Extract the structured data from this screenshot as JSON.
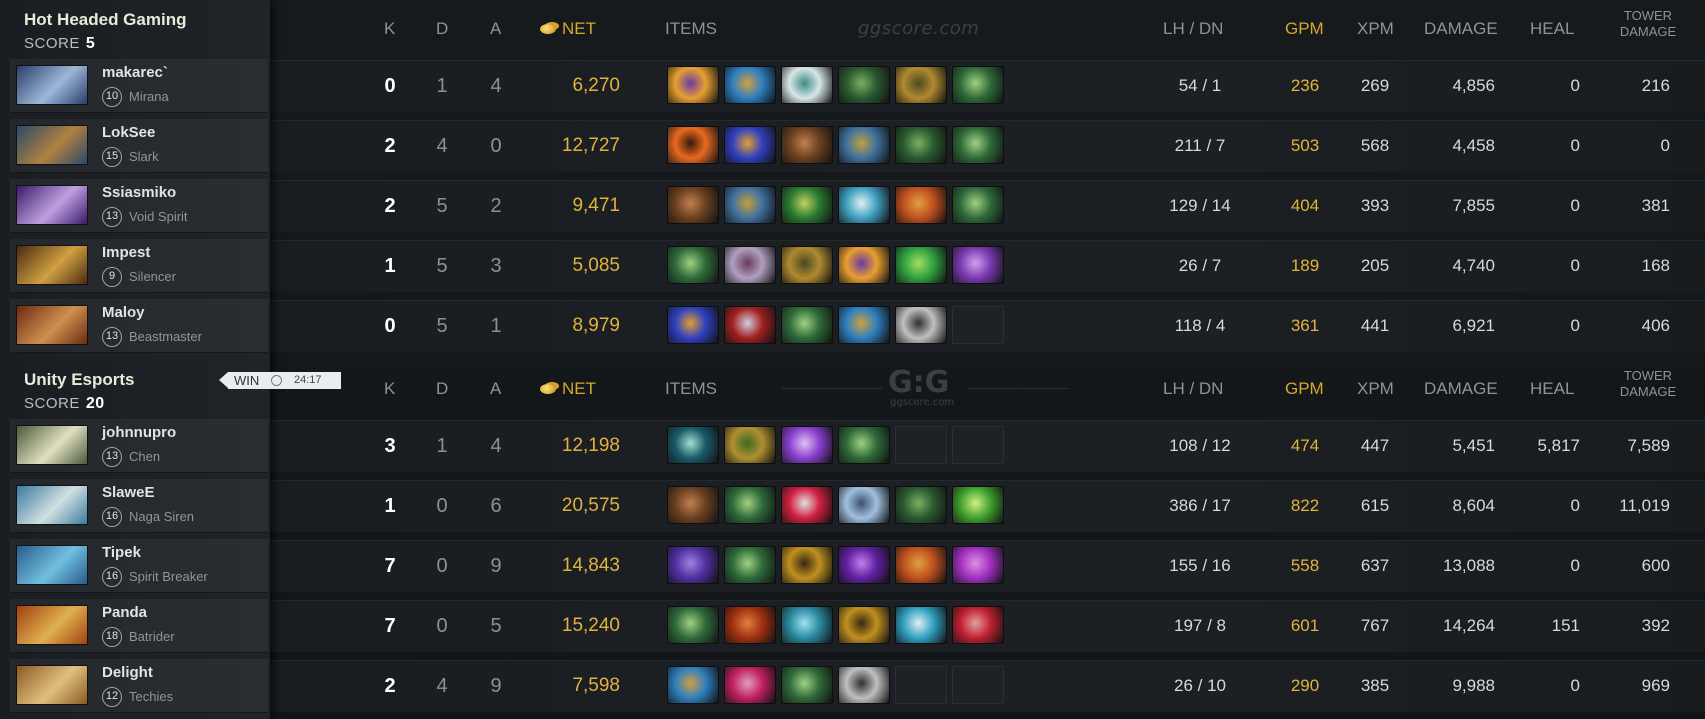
{
  "watermark": {
    "top": "ggscore.com",
    "logo": "G:G",
    "logo_sub": "ggscore.com"
  },
  "headers": {
    "k": "K",
    "d": "D",
    "a": "A",
    "net": "NET",
    "items": "ITEMS",
    "lhdn": "LH  /  DN",
    "gpm": "GPM",
    "xpm": "XPM",
    "damage": "DAMAGE",
    "heal": "HEAL",
    "tower_l1": "TOWER",
    "tower_l2": "DAMAGE"
  },
  "result": {
    "label": "WIN",
    "time": "24:17"
  },
  "teams": [
    {
      "name": "Hot Headed Gaming",
      "score_label": "SCORE",
      "score": "5",
      "players": [
        {
          "name": "makarec`",
          "level": "10",
          "hero": "Mirana",
          "k": "0",
          "d": "1",
          "a": "4",
          "net": "6,270",
          "lh_dn": "54  /  1",
          "gpm": "236",
          "xpm": "269",
          "damage": "4,856",
          "heal": "0",
          "tower": "216",
          "avatar": [
            "#2a3d6a",
            "#9db7d8"
          ],
          "items": [
            [
              "#e8a030",
              "#6a3aa0"
            ],
            [
              "#2f7fc0",
              "#d0a040"
            ],
            [
              "#d8e6e8",
              "#3d8d85"
            ],
            [
              "#2a5a30",
              "#7ab060"
            ],
            [
              "#b08a30",
              "#4a4a20"
            ],
            [
              "#2f6a3a",
              "#a0d080"
            ]
          ]
        },
        {
          "name": "LokSee",
          "level": "15",
          "hero": "Slark",
          "k": "2",
          "d": "4",
          "a": "0",
          "net": "12,727",
          "lh_dn": "211  /  7",
          "gpm": "503",
          "xpm": "568",
          "damage": "4,458",
          "heal": "0",
          "tower": "0",
          "avatar": [
            "#2a4a6a",
            "#b08040"
          ],
          "items": [
            [
              "#e86a20",
              "#3a1a0a"
            ],
            [
              "#3040c0",
              "#e0a030"
            ],
            [
              "#6a4020",
              "#c08050"
            ],
            [
              "#4070a0",
              "#c0a040"
            ],
            [
              "#2a5a30",
              "#7ab060"
            ],
            [
              "#2f6a3a",
              "#a0d080"
            ]
          ]
        },
        {
          "name": "Ssiasmiko",
          "level": "13",
          "hero": "Void Spirit",
          "k": "2",
          "d": "5",
          "a": "2",
          "net": "9,471",
          "lh_dn": "129  /  14",
          "gpm": "404",
          "xpm": "393",
          "damage": "7,855",
          "heal": "0",
          "tower": "381",
          "avatar": [
            "#3a1a6a",
            "#c0a0e0"
          ],
          "items": [
            [
              "#6a4020",
              "#c08050"
            ],
            [
              "#4070a0",
              "#c0a040"
            ],
            [
              "#2a7a30",
              "#c0d060"
            ],
            [
              "#40a0c0",
              "#e0f0f0"
            ],
            [
              "#c05020",
              "#e0a040"
            ],
            [
              "#2f6a3a",
              "#a0d080"
            ]
          ]
        },
        {
          "name": "Impest",
          "level": "9",
          "hero": "Silencer",
          "k": "1",
          "d": "5",
          "a": "3",
          "net": "5,085",
          "lh_dn": "26  /  7",
          "gpm": "189",
          "xpm": "205",
          "damage": "4,740",
          "heal": "0",
          "tower": "168",
          "avatar": [
            "#4a2a10",
            "#d0a040"
          ],
          "items": [
            [
              "#2f6a3a",
              "#a0d080"
            ],
            [
              "#b0a0c0",
              "#6a3a5a"
            ],
            [
              "#b08a30",
              "#4a4a20"
            ],
            [
              "#e8a030",
              "#6a3aa0"
            ],
            [
              "#30a040",
              "#a0e060"
            ],
            [
              "#7a3ab0",
              "#d0a0f0"
            ]
          ]
        },
        {
          "name": "Maloy",
          "level": "13",
          "hero": "Beastmaster",
          "k": "0",
          "d": "5",
          "a": "1",
          "net": "8,979",
          "lh_dn": "118  /  4",
          "gpm": "361",
          "xpm": "441",
          "damage": "6,921",
          "heal": "0",
          "tower": "406",
          "avatar": [
            "#6a2a10",
            "#d09050"
          ],
          "items": [
            [
              "#3040c0",
              "#e0a030"
            ],
            [
              "#a02020",
              "#d0d0e0"
            ],
            [
              "#2f6a3a",
              "#a0d080"
            ],
            [
              "#2f7fc0",
              "#d0a040"
            ],
            [
              "#c0c0c0",
              "#303030"
            ],
            null
          ]
        }
      ]
    },
    {
      "name": "Unity Esports",
      "score_label": "SCORE",
      "score": "20",
      "players": [
        {
          "name": "johnnupro",
          "level": "13",
          "hero": "Chen",
          "k": "3",
          "d": "1",
          "a": "4",
          "net": "12,198",
          "lh_dn": "108  /  12",
          "gpm": "474",
          "xpm": "447",
          "damage": "5,451",
          "heal": "5,817",
          "tower": "7,589",
          "avatar": [
            "#4a5a3a",
            "#e0e0c0"
          ],
          "items": [
            [
              "#1a5a6a",
              "#a0e0d0"
            ],
            [
              "#b09030",
              "#3a6a20"
            ],
            [
              "#8a40d0",
              "#e0c0f0"
            ],
            [
              "#2f6a3a",
              "#a0d080"
            ],
            null,
            null
          ]
        },
        {
          "name": "SlaweE",
          "level": "16",
          "hero": "Naga Siren",
          "k": "1",
          "d": "0",
          "a": "6",
          "net": "20,575",
          "lh_dn": "386  /  17",
          "gpm": "822",
          "xpm": "615",
          "damage": "8,604",
          "heal": "0",
          "tower": "11,019",
          "avatar": [
            "#3a7aa0",
            "#d0e0e0"
          ],
          "items": [
            [
              "#6a4020",
              "#c08050"
            ],
            [
              "#2f6a3a",
              "#a0d080"
            ],
            [
              "#d02040",
              "#e0e0e0"
            ],
            [
              "#a0c0e0",
              "#405070"
            ],
            [
              "#2a5a30",
              "#7ab060"
            ],
            [
              "#40a030",
              "#d0f080"
            ]
          ]
        },
        {
          "name": "Tipek",
          "level": "16",
          "hero": "Spirit Breaker",
          "k": "7",
          "d": "0",
          "a": "9",
          "net": "14,843",
          "lh_dn": "155  /  16",
          "gpm": "558",
          "xpm": "637",
          "damage": "13,088",
          "heal": "0",
          "tower": "600",
          "avatar": [
            "#2a5a8a",
            "#70c0e0"
          ],
          "items": [
            [
              "#5030a0",
              "#a080e0"
            ],
            [
              "#2f6a3a",
              "#a0d080"
            ],
            [
              "#c09020",
              "#3a2a10"
            ],
            [
              "#6020a0",
              "#c080f0"
            ],
            [
              "#c05020",
              "#e0a040"
            ],
            [
              "#a030c0",
              "#e090e0"
            ]
          ]
        },
        {
          "name": "Panda",
          "level": "18",
          "hero": "Batrider",
          "k": "7",
          "d": "0",
          "a": "5",
          "net": "15,240",
          "lh_dn": "197  /  8",
          "gpm": "601",
          "xpm": "767",
          "damage": "14,264",
          "heal": "151",
          "tower": "392",
          "avatar": [
            "#a04010",
            "#e0b050"
          ],
          "items": [
            [
              "#2f6a3a",
              "#a0d080"
            ],
            [
              "#a03010",
              "#e08040"
            ],
            [
              "#2a8aa0",
              "#a0e0f0"
            ],
            [
              "#c09020",
              "#3a2a10"
            ],
            [
              "#30a0c0",
              "#e0f0f0"
            ],
            [
              "#c02030",
              "#e0a0a0"
            ]
          ]
        },
        {
          "name": "Delight",
          "level": "12",
          "hero": "Techies",
          "k": "2",
          "d": "4",
          "a": "9",
          "net": "7,598",
          "lh_dn": "26  /  10",
          "gpm": "290",
          "xpm": "385",
          "damage": "9,988",
          "heal": "0",
          "tower": "969",
          "avatar": [
            "#8a5a20",
            "#e0c080"
          ],
          "items": [
            [
              "#2f7fc0",
              "#d0a040"
            ],
            [
              "#c02060",
              "#e0a0c0"
            ],
            [
              "#2f6a3a",
              "#a0d080"
            ],
            [
              "#c0c0c0",
              "#303030"
            ],
            null,
            null
          ]
        }
      ]
    }
  ]
}
